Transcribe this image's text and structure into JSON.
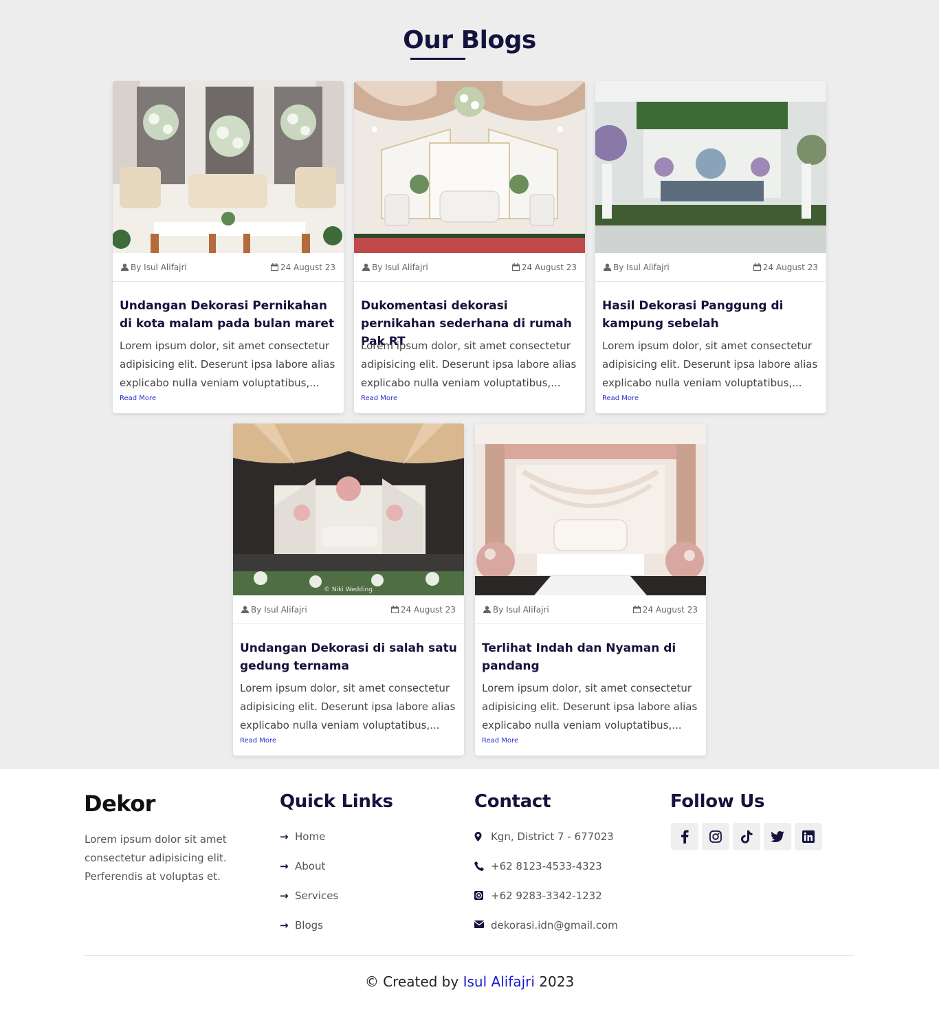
{
  "section": {
    "title": "Our Blogs"
  },
  "blogs": [
    {
      "author": "By Isul Alifajri",
      "date": "24 August 23",
      "title": "Undangan Dekorasi Pernikahan di kota malam pada bulan maret",
      "excerpt": "Lorem ipsum dolor, sit amet consectetur adipisicing elit. Deserunt ipsa labore alias explicabo nulla veniam voluptatibus,...",
      "read_more": "Read More"
    },
    {
      "author": "By Isul Alifajri",
      "date": "24 August 23",
      "title": "Dukomentasi dekorasi pernikahan sederhana di rumah Pak RT",
      "excerpt": "Lorem ipsum dolor, sit amet consectetur adipisicing elit. Deserunt ipsa labore alias explicabo nulla veniam voluptatibus,...",
      "read_more": "Read More"
    },
    {
      "author": "By Isul Alifajri",
      "date": "24 August 23",
      "title": "Hasil Dekorasi Panggung di kampung sebelah",
      "excerpt": "Lorem ipsum dolor, sit amet consectetur adipisicing elit. Deserunt ipsa labore alias explicabo nulla veniam voluptatibus,...",
      "read_more": "Read More"
    },
    {
      "author": "By Isul Alifajri",
      "date": "24 August 23",
      "title": "Undangan Dekorasi di salah satu gedung ternama",
      "excerpt": "Lorem ipsum dolor, sit amet consectetur adipisicing elit. Deserunt ipsa labore alias explicabo nulla veniam voluptatibus,...",
      "read_more": "Read More",
      "image_watermark": "© Niki Wedding"
    },
    {
      "author": "By Isul Alifajri",
      "date": "24 August 23",
      "title": "Terlihat Indah dan Nyaman di pandang",
      "excerpt": "Lorem ipsum dolor, sit amet consectetur adipisicing elit. Deserunt ipsa labore alias explicabo nulla veniam voluptatibus,...",
      "read_more": "Read More"
    }
  ],
  "footer": {
    "brand": "Dekor",
    "about": "Lorem ipsum dolor sit amet consectetur adipisicing elit. Perferendis at voluptas et.",
    "quick_links_title": "Quick Links",
    "quick_links": [
      "Home",
      "About",
      "Services",
      "Blogs"
    ],
    "contact_title": "Contact",
    "contact": {
      "address": "Kgn, District 7 - 677023",
      "phone": "+62 8123-4533-4323",
      "whatsapp": "+62 9283-3342-1232",
      "email": "dekorasi.idn@gmail.com"
    },
    "follow_title": "Follow Us",
    "socials": [
      "facebook-icon",
      "instagram-icon",
      "tiktok-icon",
      "twitter-icon",
      "linkedin-icon"
    ],
    "copyright_prefix": "© Created by",
    "copyright_author": "Isul Alifajri",
    "copyright_year": "2023"
  },
  "colors": {
    "primary": "#15133d",
    "accent_link": "#2b2bd4",
    "author_link": "#1a1ad0"
  }
}
